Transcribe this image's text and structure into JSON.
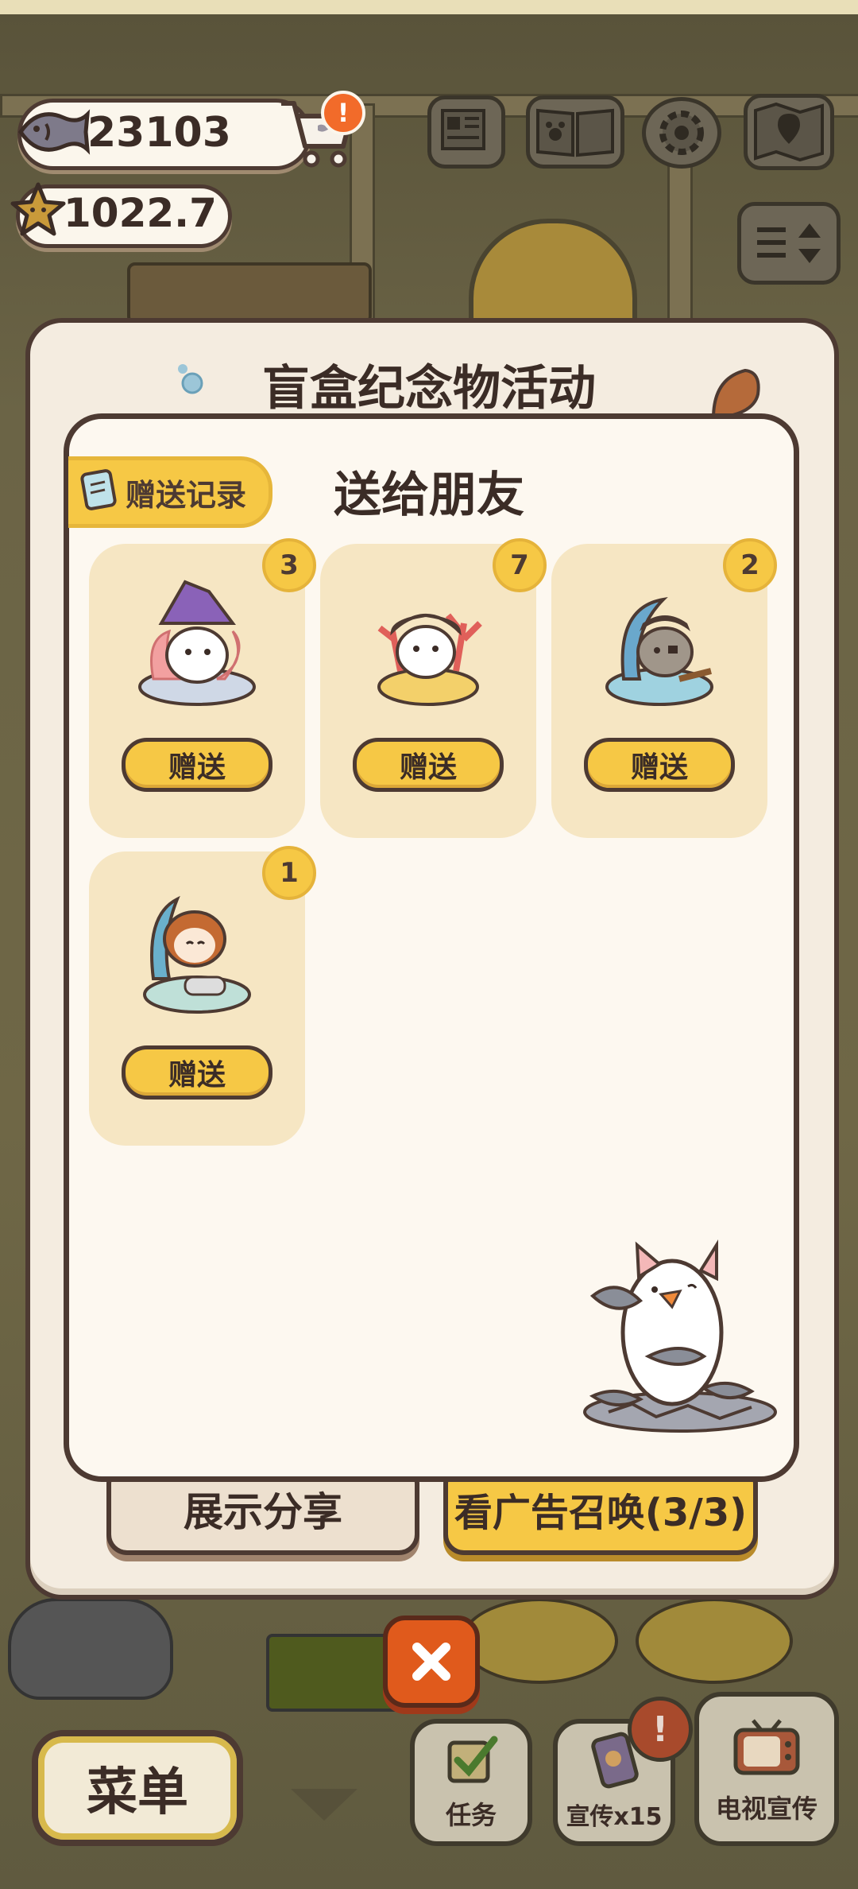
{
  "hud": {
    "fish_count": "23103",
    "star_count": "1022.7"
  },
  "dialog": {
    "title": "盲盒纪念物活动",
    "share_label": "展示分享",
    "ad_label": "看广告召唤(3/3)"
  },
  "gift_panel": {
    "title": "送给朋友",
    "record_label": "赠送记录",
    "items": [
      {
        "count": "3",
        "button_label": "赠送",
        "icon": "witch-cat-figurine-icon"
      },
      {
        "count": "7",
        "button_label": "赠送",
        "icon": "coral-cat-figurine-icon"
      },
      {
        "count": "2",
        "button_label": "赠送",
        "icon": "pirate-cat-figurine-icon"
      },
      {
        "count": "1",
        "button_label": "赠送",
        "icon": "crab-cat-figurine-icon"
      }
    ]
  },
  "bottom": {
    "menu_label": "菜单",
    "task_label": "任务",
    "promo_label": "宣传x15",
    "tv_label": "电视宣传"
  },
  "colors": {
    "accent_yellow": "#f6c845",
    "outline_brown": "#4d3a32",
    "panel_cream": "#fdf8f0",
    "card_tan": "#f6e6c3",
    "close_orange": "#e05a1c",
    "alert_orange": "#f26b2a"
  }
}
